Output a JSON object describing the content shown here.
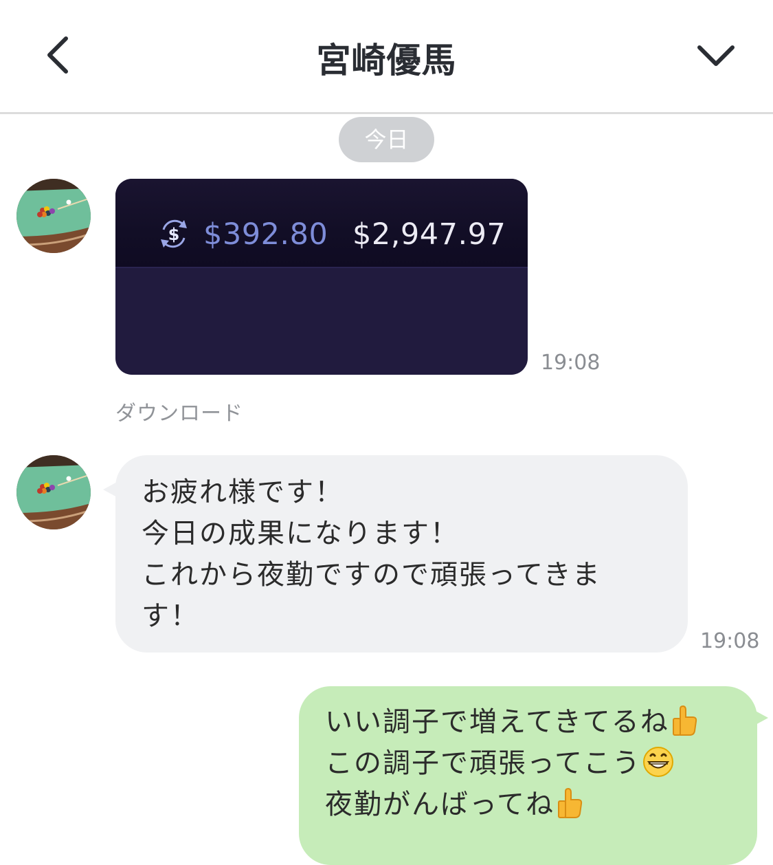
{
  "header": {
    "title": "宮崎優馬",
    "back_icon": "chevron-left-icon",
    "menu_icon": "chevron-down-icon"
  },
  "date_divider": "今日",
  "messages": [
    {
      "type": "image",
      "image": {
        "icon": "currency-exchange-icon",
        "amount_1": "$392.80",
        "amount_2": "$2,947.97"
      },
      "time": "19:08",
      "download_label": "ダウンロード"
    },
    {
      "type": "text",
      "text": "お疲れ様です！\n今日の成果になります！\nこれから夜勤ですので頑張ってきま\nす！",
      "time": "19:08"
    },
    {
      "type": "text_outgoing",
      "lines": [
        "いい調子で増えてきてるね",
        "この調子で頑張ってこう",
        "夜勤がんばってね"
      ],
      "line_emojis": [
        "thumbs-up-icon",
        "grinning-face-icon",
        "thumbs-up-icon"
      ]
    }
  ],
  "colors": {
    "incoming_bubble": "#f0f1f3",
    "outgoing_bubble": "#c6ecb9",
    "date_pill": "#cfd1d4",
    "image_bg": "#211b3e"
  }
}
